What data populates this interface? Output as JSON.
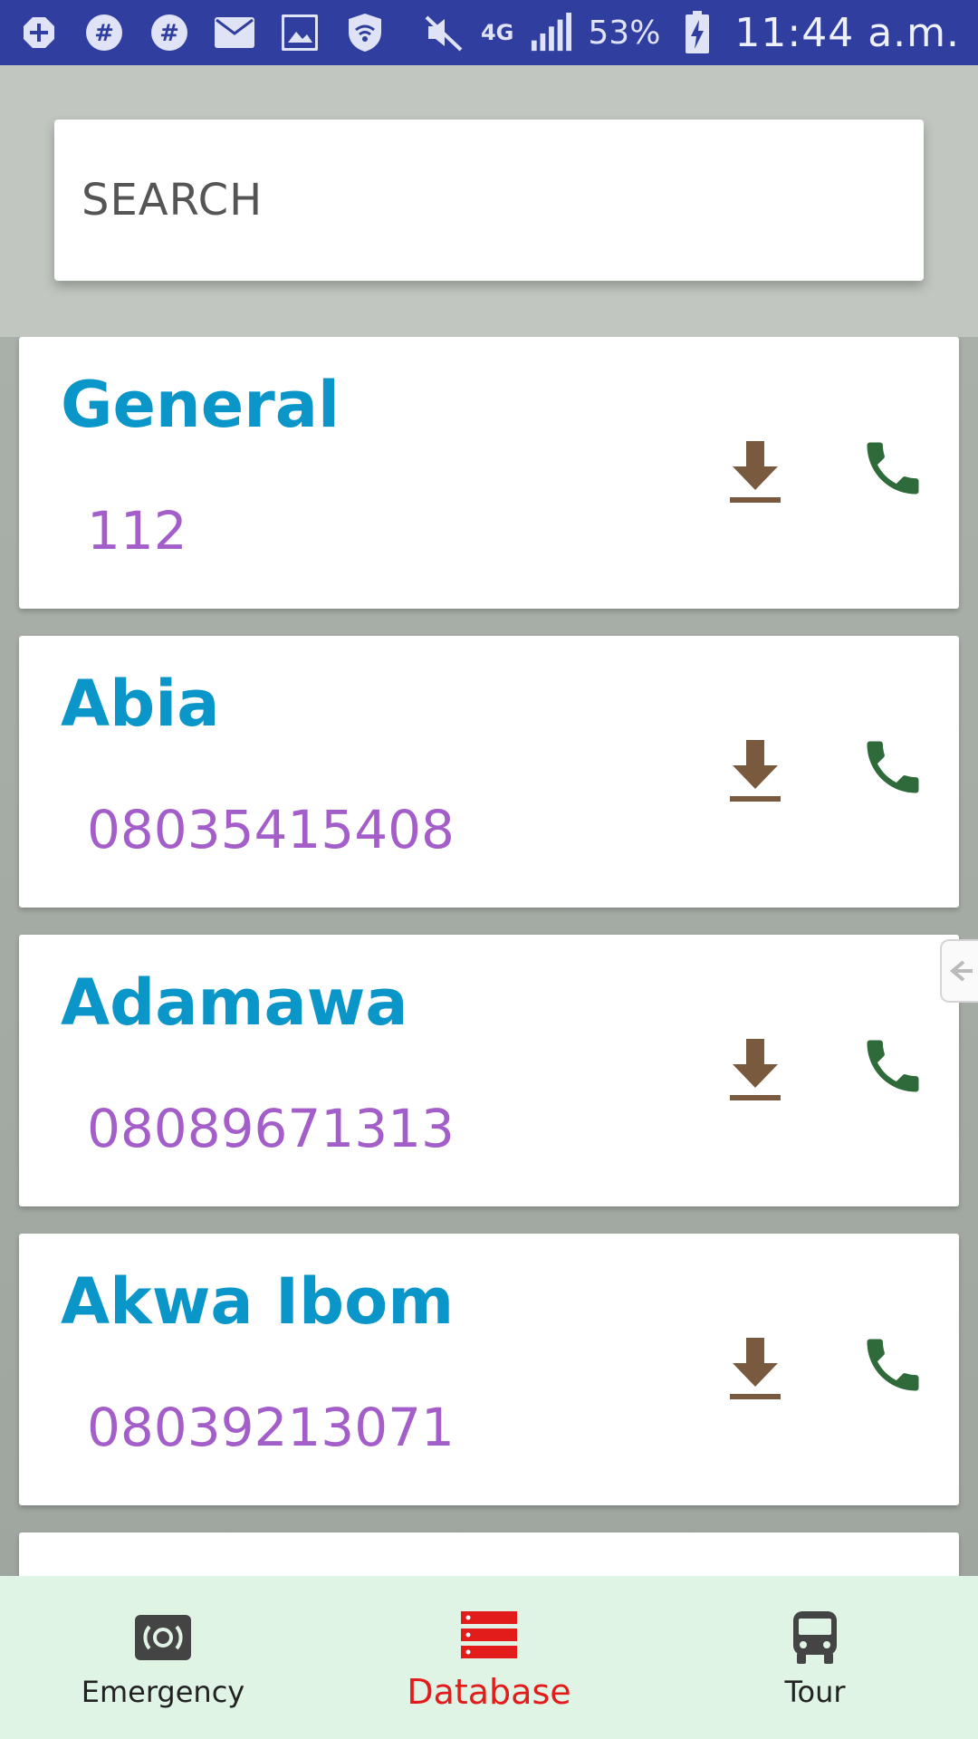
{
  "status_bar": {
    "network": "4G",
    "battery": "53%",
    "time": "11:44 a.m."
  },
  "search": {
    "placeholder": "SEARCH",
    "value": ""
  },
  "contacts": [
    {
      "name": "General",
      "phone": "112"
    },
    {
      "name": "Abia",
      "phone": "08035415408"
    },
    {
      "name": "Adamawa",
      "phone": "08089671313"
    },
    {
      "name": "Akwa Ibom",
      "phone": "08039213071"
    }
  ],
  "bottom_nav": {
    "items": [
      {
        "label": "Emergency",
        "icon": "emergency-icon"
      },
      {
        "label": "Database",
        "icon": "database-icon",
        "active": true
      },
      {
        "label": "Tour",
        "icon": "bus-icon"
      }
    ]
  },
  "colors": {
    "status_bar": "#303f9f",
    "contact_name": "#0a96c8",
    "contact_phone": "#a45ec9",
    "download_icon": "#7a5a3e",
    "call_icon": "#2f6b3a",
    "nav_active": "#e21b1b",
    "nav_background": "#e0f4e6"
  }
}
